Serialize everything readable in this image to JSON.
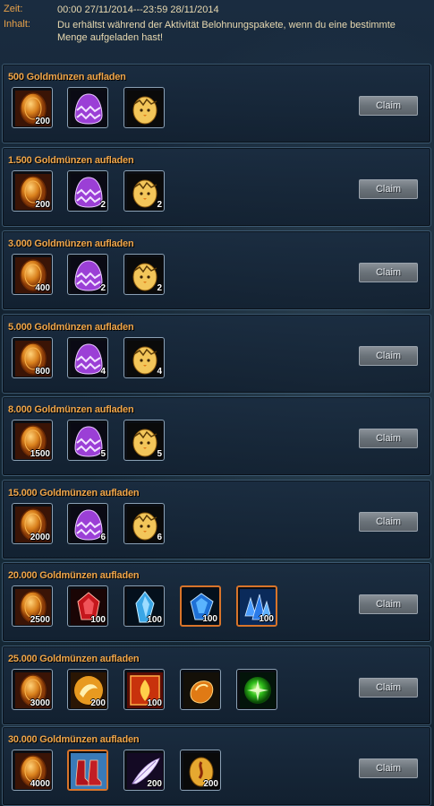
{
  "header": {
    "zeit_label": "Zeit:",
    "zeit_value": "00:00 27/11/2014---23:59 28/11/2014",
    "inhalt_label": "Inhalt:",
    "inhalt_value": "Du erhältst während der Aktivität Belohnungspakete, wenn du eine bestimmte Menge aufgeladen hast!"
  },
  "claim_label": "Claim",
  "rows": [
    {
      "title": "500 Goldmünzen aufladen",
      "items": [
        {
          "icon": "gold-coin-icon",
          "qty": "200"
        },
        {
          "icon": "purple-egg-icon",
          "qty": ""
        },
        {
          "icon": "golden-egg-icon",
          "qty": ""
        }
      ]
    },
    {
      "title": "1.500 Goldmünzen aufladen",
      "items": [
        {
          "icon": "gold-coin-icon",
          "qty": "200"
        },
        {
          "icon": "purple-egg-icon",
          "qty": "2"
        },
        {
          "icon": "golden-egg-icon",
          "qty": "2"
        }
      ]
    },
    {
      "title": "3.000 Goldmünzen aufladen",
      "items": [
        {
          "icon": "gold-coin-icon",
          "qty": "400"
        },
        {
          "icon": "purple-egg-icon",
          "qty": "2"
        },
        {
          "icon": "golden-egg-icon",
          "qty": "2"
        }
      ]
    },
    {
      "title": "5.000 Goldmünzen aufladen",
      "items": [
        {
          "icon": "gold-coin-icon",
          "qty": "800"
        },
        {
          "icon": "purple-egg-icon",
          "qty": "4"
        },
        {
          "icon": "golden-egg-icon",
          "qty": "4"
        }
      ]
    },
    {
      "title": "8.000 Goldmünzen aufladen",
      "items": [
        {
          "icon": "gold-coin-icon",
          "qty": "1500"
        },
        {
          "icon": "purple-egg-icon",
          "qty": "5"
        },
        {
          "icon": "golden-egg-icon",
          "qty": "5"
        }
      ]
    },
    {
      "title": "15.000 Goldmünzen aufladen",
      "items": [
        {
          "icon": "gold-coin-icon",
          "qty": "2000"
        },
        {
          "icon": "purple-egg-icon",
          "qty": "6"
        },
        {
          "icon": "golden-egg-icon",
          "qty": "6"
        }
      ]
    },
    {
      "title": "20.000 Goldmünzen aufladen",
      "items": [
        {
          "icon": "gold-coin-icon",
          "qty": "2500"
        },
        {
          "icon": "red-gem-icon",
          "qty": "100"
        },
        {
          "icon": "blue-crystal-icon",
          "qty": "100"
        },
        {
          "icon": "blue-gem-icon",
          "qty": "100"
        },
        {
          "icon": "blue-crystal-cluster-icon",
          "qty": "100"
        }
      ]
    },
    {
      "title": "25.000 Goldmünzen aufladen",
      "items": [
        {
          "icon": "gold-coin-icon",
          "qty": "3000"
        },
        {
          "icon": "golden-horn-icon",
          "qty": "200"
        },
        {
          "icon": "fire-rune-icon",
          "qty": "100"
        },
        {
          "icon": "amber-stone-icon",
          "qty": ""
        },
        {
          "icon": "green-orb-icon",
          "qty": ""
        }
      ]
    },
    {
      "title": "30.000 Goldmünzen aufladen",
      "items": [
        {
          "icon": "gold-coin-icon",
          "qty": "4000"
        },
        {
          "icon": "red-boots-icon",
          "qty": ""
        },
        {
          "icon": "white-feather-icon",
          "qty": "200"
        },
        {
          "icon": "golden-scroll-icon",
          "qty": "200"
        }
      ]
    }
  ]
}
